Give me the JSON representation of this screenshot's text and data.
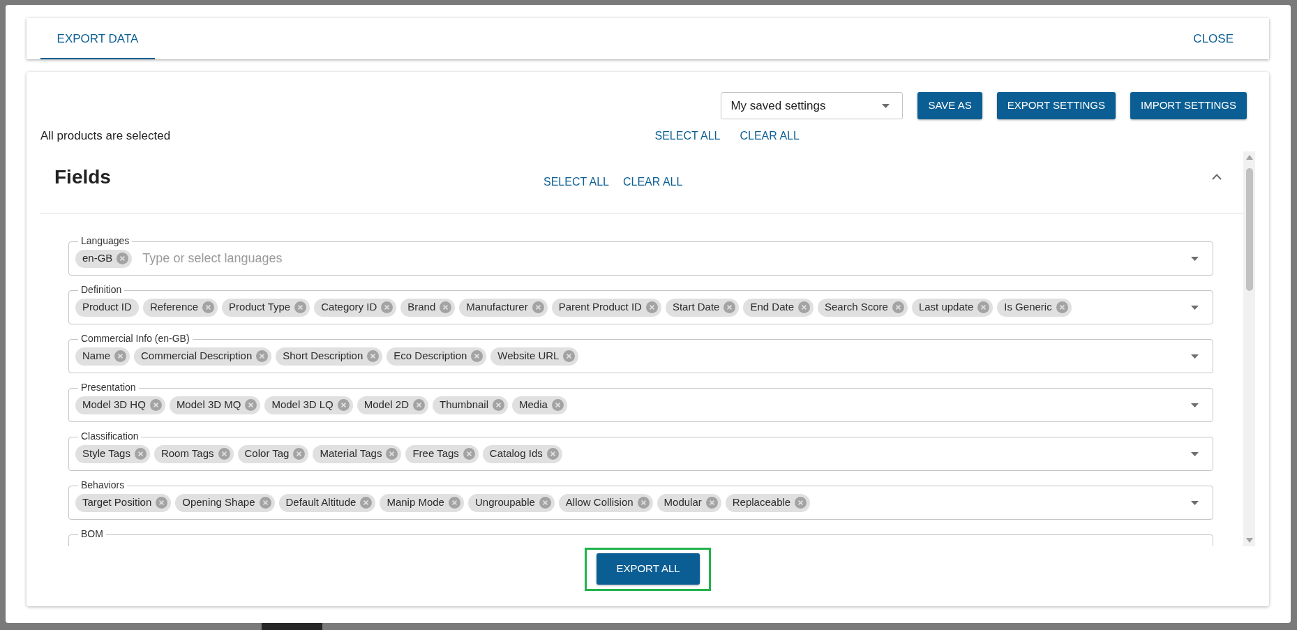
{
  "dialog": {
    "tabs": [
      {
        "label": "EXPORT DATA",
        "selected": true
      }
    ],
    "close_label": "CLOSE"
  },
  "settings": {
    "saved_settings": "My saved settings",
    "buttons": [
      "SAVE AS",
      "EXPORT SETTINGS",
      "IMPORT SETTINGS"
    ]
  },
  "products": {
    "status": "All products are selected",
    "select_all": "SELECT ALL",
    "clear_all": "CLEAR ALL"
  },
  "fields_panel": {
    "title": "Fields",
    "select_all": "SELECT ALL",
    "clear_all": "CLEAR ALL",
    "expanded": true,
    "groups": [
      {
        "label": "Languages",
        "chips": [
          {
            "label": "en-GB",
            "removable": true
          }
        ],
        "placeholder": "Type or select languages"
      },
      {
        "label": "Definition",
        "chips": [
          {
            "label": "Product ID",
            "removable": false
          },
          {
            "label": "Reference",
            "removable": true
          },
          {
            "label": "Product Type",
            "removable": true
          },
          {
            "label": "Category ID",
            "removable": true
          },
          {
            "label": "Brand",
            "removable": true
          },
          {
            "label": "Manufacturer",
            "removable": true
          },
          {
            "label": "Parent Product ID",
            "removable": true
          },
          {
            "label": "Start Date",
            "removable": true
          },
          {
            "label": "End Date",
            "removable": true
          },
          {
            "label": "Search Score",
            "removable": true
          },
          {
            "label": "Last update",
            "removable": true
          },
          {
            "label": "Is Generic",
            "removable": true
          }
        ]
      },
      {
        "label": "Commercial Info (en-GB)",
        "chips": [
          {
            "label": "Name",
            "removable": true
          },
          {
            "label": "Commercial Description",
            "removable": true
          },
          {
            "label": "Short Description",
            "removable": true
          },
          {
            "label": "Eco Description",
            "removable": true
          },
          {
            "label": "Website URL",
            "removable": true
          }
        ]
      },
      {
        "label": "Presentation",
        "chips": [
          {
            "label": "Model 3D HQ",
            "removable": true
          },
          {
            "label": "Model 3D MQ",
            "removable": true
          },
          {
            "label": "Model 3D LQ",
            "removable": true
          },
          {
            "label": "Model 2D",
            "removable": true
          },
          {
            "label": "Thumbnail",
            "removable": true
          },
          {
            "label": "Media",
            "removable": true
          }
        ]
      },
      {
        "label": "Classification",
        "chips": [
          {
            "label": "Style Tags",
            "removable": true
          },
          {
            "label": "Room Tags",
            "removable": true
          },
          {
            "label": "Color Tag",
            "removable": true
          },
          {
            "label": "Material Tags",
            "removable": true
          },
          {
            "label": "Free Tags",
            "removable": true
          },
          {
            "label": "Catalog Ids",
            "removable": true
          }
        ]
      },
      {
        "label": "Behaviors",
        "chips": [
          {
            "label": "Target Position",
            "removable": true
          },
          {
            "label": "Opening Shape",
            "removable": true
          },
          {
            "label": "Default Altitude",
            "removable": true
          },
          {
            "label": "Manip Mode",
            "removable": true
          },
          {
            "label": "Ungroupable",
            "removable": true
          },
          {
            "label": "Allow Collision",
            "removable": true
          },
          {
            "label": "Modular",
            "removable": true
          },
          {
            "label": "Replaceable",
            "removable": true
          }
        ]
      },
      {
        "label": "BOM"
      }
    ]
  },
  "export_button": {
    "label": "EXPORT ALL",
    "highlighted": true
  }
}
